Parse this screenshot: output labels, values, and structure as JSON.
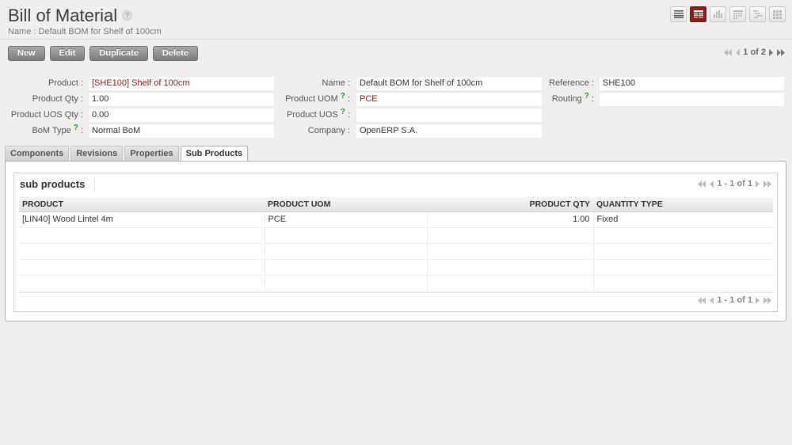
{
  "header": {
    "title": "Bill of Material",
    "help": "?",
    "subtitle": "Name : Default BOM for Shelf of 100cm"
  },
  "views": [
    {
      "name": "list-view",
      "icon": "list-icon",
      "active": false
    },
    {
      "name": "form-view",
      "icon": "form-icon",
      "active": true
    },
    {
      "name": "graph-view",
      "icon": "bar-chart-icon",
      "active": false
    },
    {
      "name": "calendar-view",
      "icon": "calendar-icon",
      "active": false
    },
    {
      "name": "gantt-view",
      "icon": "gantt-icon",
      "active": false
    },
    {
      "name": "kanban-view",
      "icon": "grid-icon",
      "active": false
    }
  ],
  "toolbar": {
    "new_label": "New",
    "edit_label": "Edit",
    "duplicate_label": "Duplicate",
    "delete_label": "Delete"
  },
  "pager": {
    "text": "1 of 2"
  },
  "form": {
    "product": {
      "label": "Product :",
      "value": "[SHE100] Shelf of 100cm"
    },
    "product_qty": {
      "label": "Product Qty :",
      "value": "1.00"
    },
    "product_uos_qty": {
      "label": "Product UOS Qty :",
      "value": "0.00"
    },
    "bom_type": {
      "label": "BoM Type",
      "help": "?",
      "colon": ":",
      "value": "Normal BoM"
    },
    "name": {
      "label": "Name :",
      "value": "Default BOM for Shelf of 100cm"
    },
    "product_uom": {
      "label": "Product UOM",
      "help": "?",
      "colon": ":",
      "value": "PCE"
    },
    "product_uos": {
      "label": "Product UOS",
      "help": "?",
      "colon": ":",
      "value": ""
    },
    "company": {
      "label": "Company :",
      "value": "OpenERP S.A."
    },
    "reference": {
      "label": "Reference :",
      "value": "SHE100"
    },
    "routing": {
      "label": "Routing",
      "help": "?",
      "colon": ":",
      "value": ""
    }
  },
  "tabs": [
    {
      "label": "Components",
      "active": false
    },
    {
      "label": "Revisions",
      "active": false
    },
    {
      "label": "Properties",
      "active": false
    },
    {
      "label": "Sub Products",
      "active": true
    }
  ],
  "sub_products": {
    "title": "sub products",
    "pager_text": "1 - 1 of 1",
    "columns": [
      "PRODUCT",
      "PRODUCT UOM",
      "PRODUCT QTY",
      "QUANTITY TYPE"
    ],
    "rows": [
      [
        "[LIN40] Wood Lintel 4m",
        "PCE",
        "1.00",
        "Fixed"
      ],
      [
        "",
        "",
        "",
        ""
      ],
      [
        "",
        "",
        "",
        ""
      ],
      [
        "",
        "",
        "",
        ""
      ],
      [
        "",
        "",
        "",
        ""
      ]
    ]
  },
  "colors": {
    "accent": "#8a1e1e",
    "link": "#8b1a1a",
    "help_green": "#2a9a2a"
  }
}
